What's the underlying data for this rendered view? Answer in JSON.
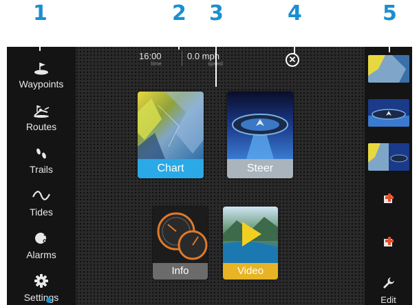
{
  "callouts": [
    "1",
    "2",
    "3",
    "4",
    "5"
  ],
  "sidebar": {
    "items": [
      {
        "label": "Waypoints",
        "icon": "waypoint-flag-icon"
      },
      {
        "label": "Routes",
        "icon": "route-icon"
      },
      {
        "label": "Trails",
        "icon": "trail-footprints-icon"
      },
      {
        "label": "Tides",
        "icon": "tide-wave-icon"
      },
      {
        "label": "Alarms",
        "icon": "alarm-bell-icon"
      },
      {
        "label": "Settings",
        "icon": "gear-icon"
      }
    ]
  },
  "status": {
    "time_value": "16:00",
    "time_unit": "time",
    "speed_value": "0.0 mph",
    "speed_unit": "speed"
  },
  "tiles": [
    {
      "label": "Chart",
      "caption_color": "#2aa9e6"
    },
    {
      "label": "Steer",
      "caption_color": "#a9b4bd"
    },
    {
      "label": "Info",
      "caption_color": "#6b6b6b"
    },
    {
      "label": "Video",
      "caption_color": "#e6b425"
    }
  ],
  "rightbar": {
    "favorites": [
      "chart-favorite",
      "steer-favorite",
      "chart-steer-split-favorite"
    ],
    "edit_label": "Edit"
  },
  "colors": {
    "callout": "#1a8fd0",
    "accent_add": "#e2502a"
  }
}
